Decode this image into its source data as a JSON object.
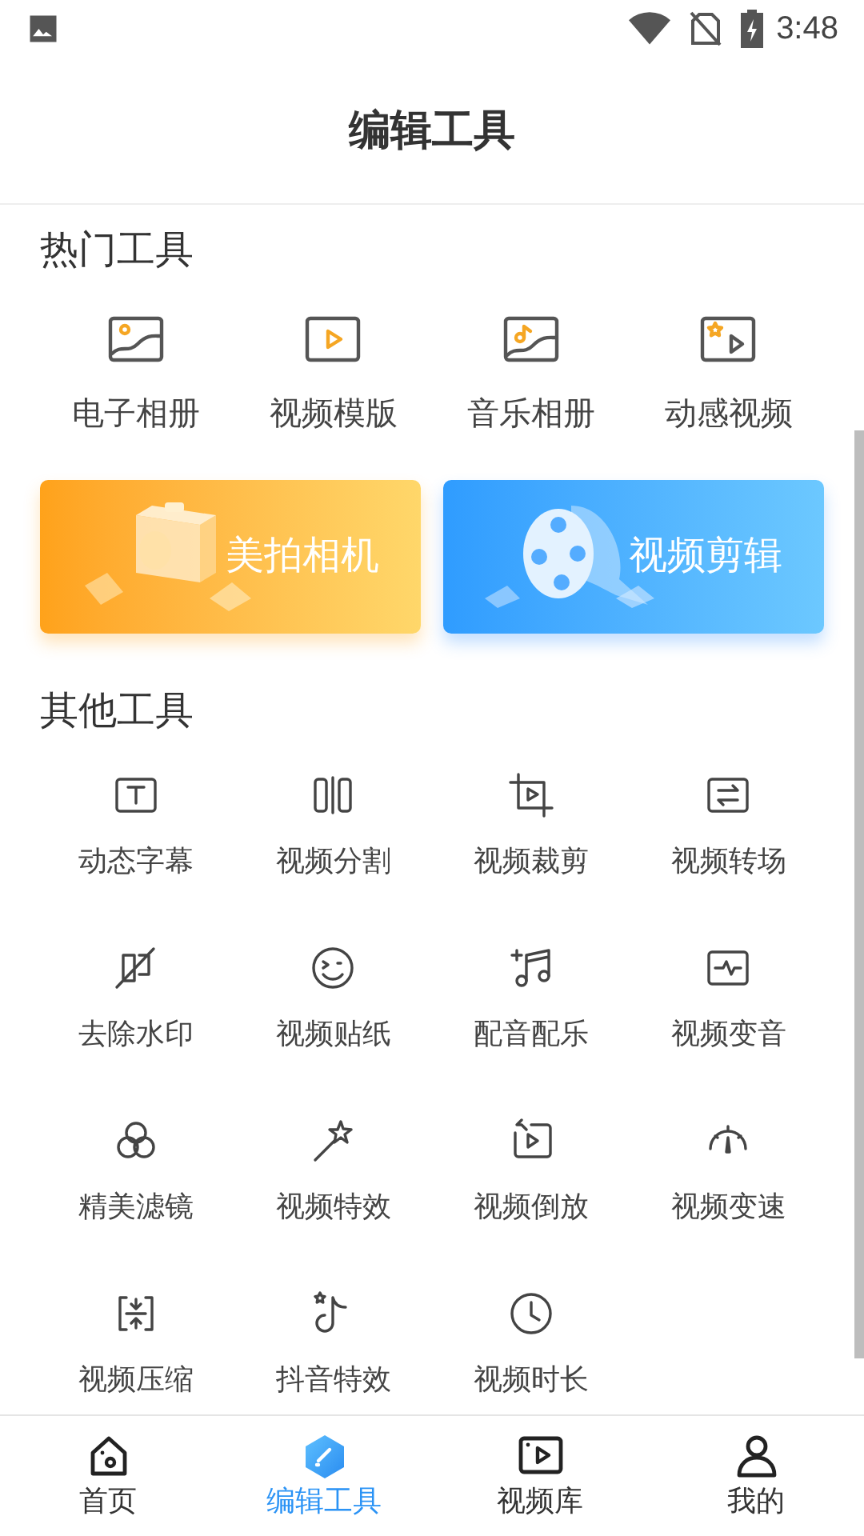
{
  "status_bar": {
    "time": "3:48"
  },
  "header": {
    "title": "编辑工具"
  },
  "hot_tools": {
    "title": "热门工具",
    "items": [
      {
        "label": "电子相册"
      },
      {
        "label": "视频模版"
      },
      {
        "label": "音乐相册"
      },
      {
        "label": "动感视频"
      }
    ]
  },
  "banners": [
    {
      "label": "美拍相机",
      "kind": "camera"
    },
    {
      "label": "视频剪辑",
      "kind": "video"
    }
  ],
  "other_tools": {
    "title": "其他工具",
    "items": [
      {
        "label": "动态字幕"
      },
      {
        "label": "视频分割"
      },
      {
        "label": "视频裁剪"
      },
      {
        "label": "视频转场"
      },
      {
        "label": "去除水印"
      },
      {
        "label": "视频贴纸"
      },
      {
        "label": "配音配乐"
      },
      {
        "label": "视频变音"
      },
      {
        "label": "精美滤镜"
      },
      {
        "label": "视频特效"
      },
      {
        "label": "视频倒放"
      },
      {
        "label": "视频变速"
      },
      {
        "label": "视频压缩"
      },
      {
        "label": "抖音特效"
      },
      {
        "label": "视频时长"
      }
    ]
  },
  "bottom_nav": [
    {
      "label": "首页",
      "selected": false
    },
    {
      "label": "编辑工具",
      "selected": true
    },
    {
      "label": "视频库",
      "selected": false
    },
    {
      "label": "我的",
      "selected": false
    }
  ]
}
